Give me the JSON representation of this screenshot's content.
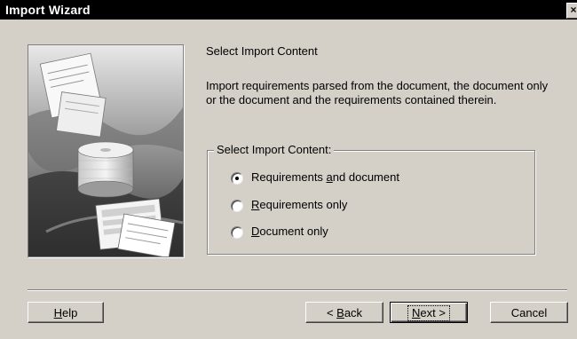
{
  "window": {
    "title": "Import Wizard",
    "close_label": "×"
  },
  "main": {
    "heading": "Select Import Content",
    "description": "Import requirements parsed from the document, the document only or the document and the requirements contained therein."
  },
  "group": {
    "label": "Select Import Content:",
    "options": [
      {
        "pre": "Requirements ",
        "key": "a",
        "post": "nd document",
        "selected": true
      },
      {
        "pre": "",
        "key": "R",
        "post": "equirements only",
        "selected": false
      },
      {
        "pre": "",
        "key": "D",
        "post": "ocument only",
        "selected": false
      }
    ]
  },
  "buttons": {
    "help": {
      "key": "H",
      "post": "elp"
    },
    "back": {
      "pre": "< ",
      "key": "B",
      "post": "ack"
    },
    "next": {
      "pre": "",
      "key": "N",
      "post": "ext >"
    },
    "cancel": "Cancel"
  }
}
